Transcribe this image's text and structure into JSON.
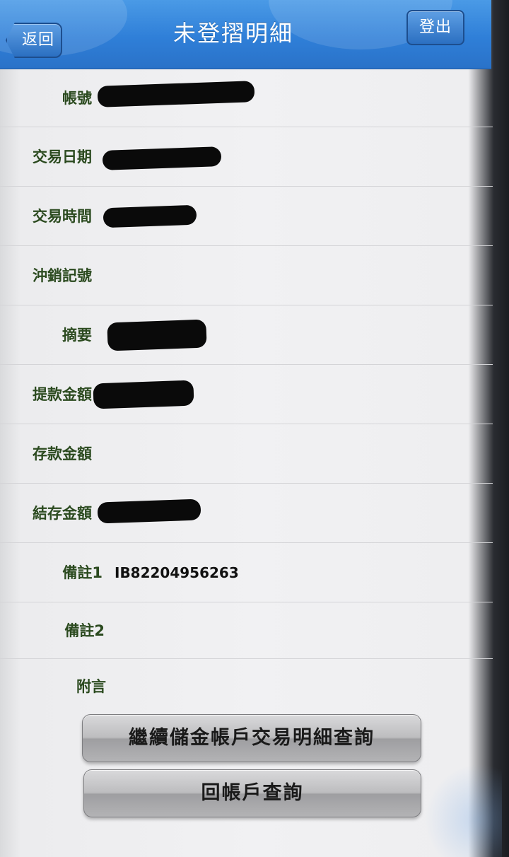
{
  "header": {
    "title": "未登摺明細",
    "back_label": "返回",
    "logout_label": "登出"
  },
  "rows": [
    {
      "label": "帳號",
      "value": ""
    },
    {
      "label": "交易日期",
      "value": ""
    },
    {
      "label": "交易時間",
      "value": ""
    },
    {
      "label": "沖銷記號",
      "value": ""
    },
    {
      "label": "摘要",
      "value": ""
    },
    {
      "label": "提款金額",
      "value": ""
    },
    {
      "label": "存款金額",
      "value": ""
    },
    {
      "label": "結存金額",
      "value": ""
    },
    {
      "label": "備註1",
      "value": "IB82204956263"
    },
    {
      "label": "備註2",
      "value": ""
    },
    {
      "label": "附言",
      "value": ""
    }
  ],
  "buttons": {
    "continue_query": "繼續儲金帳戶交易明細查詢",
    "back_to_account": "回帳戶查詢"
  },
  "colors": {
    "header_blue": "#2f7fd8",
    "label_green": "#2b4a1f"
  }
}
